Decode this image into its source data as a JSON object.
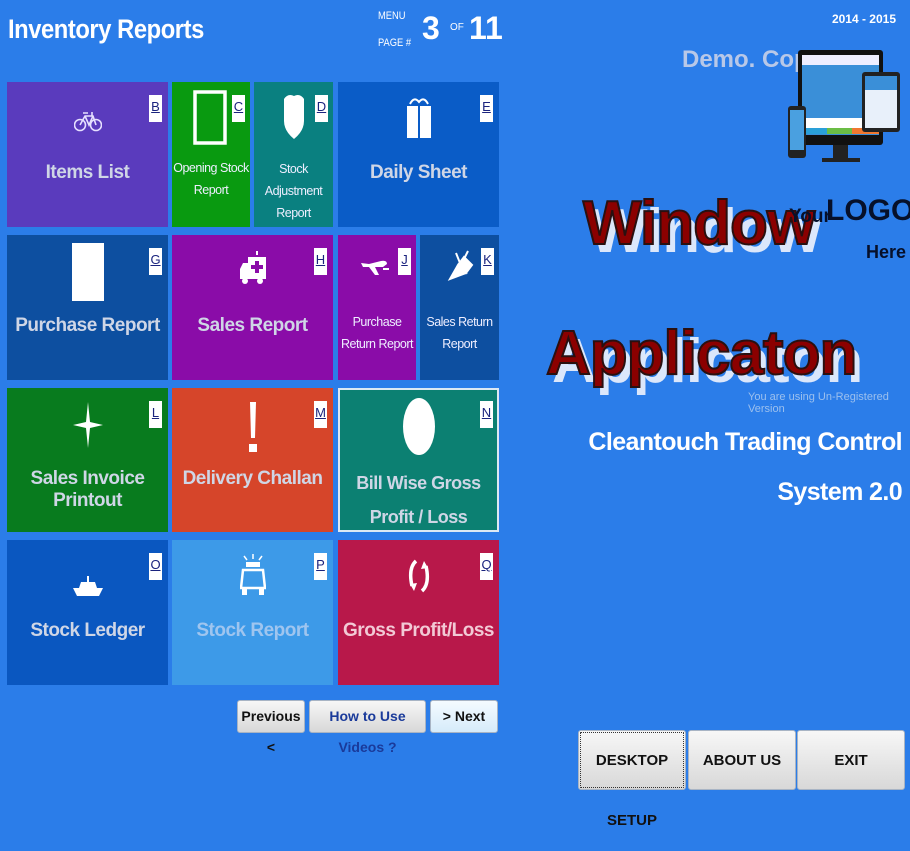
{
  "header": {
    "title": "Inventory Reports",
    "menu_label": "MENU",
    "page_label": "PAGE #",
    "current_page": "3",
    "of_label": "OF",
    "total_pages": "11"
  },
  "tiles": [
    {
      "label": "Items List",
      "key": "B",
      "icon": "bicycle-icon",
      "color": "#5a3bbd"
    },
    {
      "label": "Opening Stock Report",
      "key": "C",
      "icon": "square-outline-icon",
      "color": "#099a10"
    },
    {
      "label": "Stock Adjustment Report",
      "key": "D",
      "icon": "shield-icon",
      "color": "#0a8080"
    },
    {
      "label": "Daily Sheet",
      "key": "E",
      "icon": "gift-icon",
      "color": "#0a5cc7"
    },
    {
      "label": "Purchase Report",
      "key": "G",
      "icon": "document-icon",
      "color": "#0d4fa0"
    },
    {
      "label": "Sales Report",
      "key": "H",
      "icon": "ambulance-icon",
      "color": "#8a0ca8"
    },
    {
      "label": "Purchase Return Report",
      "key": "J",
      "icon": "airplane-icon",
      "color": "#8a0ca8"
    },
    {
      "label": "Sales Return Report",
      "key": "K",
      "icon": "satellite-icon",
      "color": "#0d4fa0"
    },
    {
      "label": "Sales Invoice Printout",
      "key": "L",
      "icon": "compass-star-icon",
      "color": "#087b1e"
    },
    {
      "label": "Delivery Challan",
      "key": "M",
      "icon": "exclamation-icon",
      "color": "#d6452a"
    },
    {
      "label": "Bill Wise Gross Profit / Loss",
      "key": "N",
      "icon": "circle-icon",
      "color": "#0c8072"
    },
    {
      "label": "Stock Ledger",
      "key": "O",
      "icon": "ship-icon",
      "color": "#0a57c0"
    },
    {
      "label": "Stock Report",
      "key": "P",
      "icon": "police-car-icon",
      "color": "#3d9ae8"
    },
    {
      "label": "Gross Profit/Loss",
      "key": "Q",
      "icon": "refresh-icon",
      "color": "#b8184a"
    }
  ],
  "nav": {
    "previous": "Previous <",
    "videos": "How to Use Videos ?",
    "next": "> Next"
  },
  "right": {
    "year": "2014 - 2015",
    "demo": "Demo. Copy",
    "watermark_line1": "Window",
    "watermark_line2": "Applicaton",
    "logo_your": "Your",
    "logo_logo": "LOGO",
    "logo_here": "Here",
    "unregistered": "You are using Un-Registered Version",
    "product_line1": "Cleantouch Trading Control",
    "product_line2": "System 2.0"
  },
  "bottom": {
    "desktop_setup": "DESKTOP SETUP",
    "about_us": "ABOUT US",
    "exit": "EXIT"
  }
}
